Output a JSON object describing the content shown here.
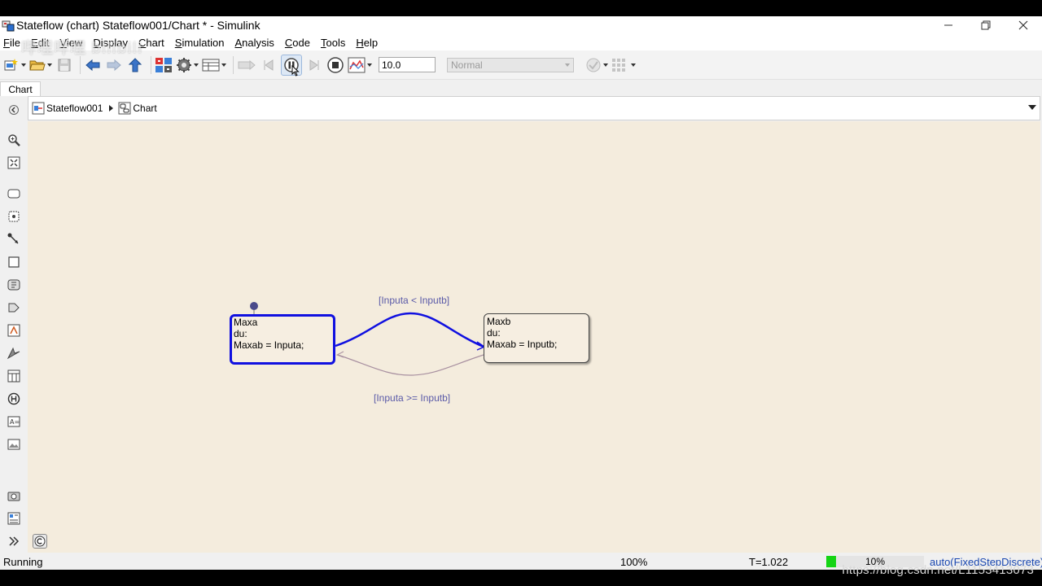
{
  "window": {
    "title": "Stateflow (chart) Stateflow001/Chart * - Simulink",
    "controls": {
      "minimize": "—",
      "restore": "❐",
      "close": "✕"
    }
  },
  "watermark": {
    "bili": "哔哩哔哩 bilibili",
    "url": "https://blog.csdn.net/L1153413073"
  },
  "menu": [
    {
      "label": "File",
      "key": "F",
      "rest": "ile"
    },
    {
      "label": "Edit",
      "key": "E",
      "rest": "dit"
    },
    {
      "label": "View",
      "key": "V",
      "rest": "iew"
    },
    {
      "label": "Display",
      "key": "D",
      "rest": "isplay"
    },
    {
      "label": "Chart",
      "key": "C",
      "rest": "hart"
    },
    {
      "label": "Simulation",
      "key": "S",
      "rest": "imulation"
    },
    {
      "label": "Analysis",
      "key": "A",
      "rest": "nalysis"
    },
    {
      "label": "Code",
      "key": "C",
      "rest": "ode"
    },
    {
      "label": "Tools",
      "key": "T",
      "rest": "ools"
    },
    {
      "label": "Help",
      "key": "H",
      "rest": "elp"
    }
  ],
  "toolbar": {
    "stop_time": "10.0",
    "sim_mode": "Normal",
    "icons": [
      "new-model-icon",
      "open-icon",
      "save-icon",
      "back-icon",
      "forward-icon",
      "up-icon",
      "library-browser-icon",
      "model-config-icon",
      "model-explorer-icon",
      "step-back-icon",
      "pause-icon",
      "step-forward-icon",
      "stop-icon",
      "scope-icon",
      "advisor-icon",
      "build-icon"
    ]
  },
  "tabs": {
    "active": "Chart"
  },
  "breadcrumb": {
    "model": "Stateflow001",
    "chart": "Chart"
  },
  "chart": {
    "states": [
      {
        "name": "Maxa",
        "lines": [
          "Maxa",
          "du:",
          "Maxab = Inputa;"
        ],
        "active": true
      },
      {
        "name": "Maxb",
        "lines": [
          "Maxb",
          "du:",
          "Maxab = Inputb;"
        ],
        "active": false
      }
    ],
    "transitions": [
      {
        "from": "Maxa",
        "to": "Maxb",
        "label": "[Inputa < Inputb]",
        "active": true
      },
      {
        "from": "Maxb",
        "to": "Maxa",
        "label": "[Inputa >= Inputb]",
        "active": false
      }
    ],
    "colors": {
      "active": "#1010e0",
      "inactive": "#a890a0",
      "canvas": "#f4ecdd"
    }
  },
  "status": {
    "state": "Running",
    "zoom": "100%",
    "time": "T=1.022",
    "progress_label": "10%",
    "progress": 0.1,
    "solver": "auto(FixedStepDiscrete)"
  }
}
